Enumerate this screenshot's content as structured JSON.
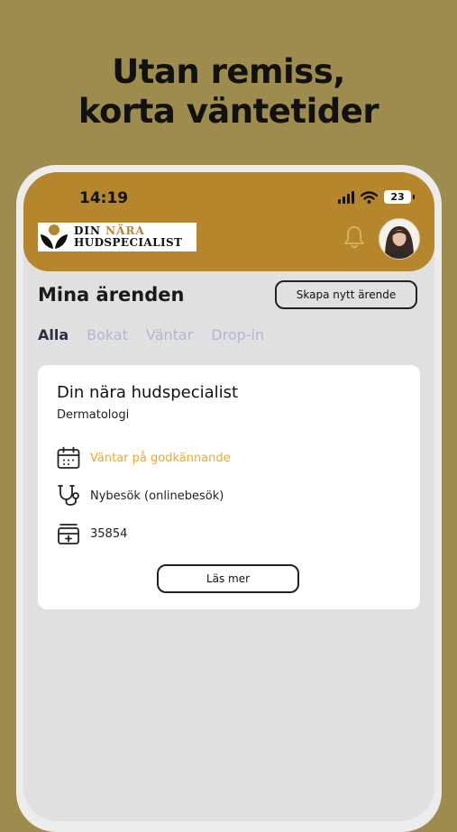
{
  "promo": {
    "headline_line1": "Utan remiss,",
    "headline_line2": "korta väntetider"
  },
  "status_bar": {
    "time": "14:19",
    "battery": "23"
  },
  "header": {
    "logo": {
      "line1_a": "DIN ",
      "line1_b": "NÄRA",
      "line2": "HUDSPECIALIST"
    },
    "icons": {
      "bell": "bell-icon",
      "avatar": "avatar"
    },
    "accent_color": "#b5862b"
  },
  "main": {
    "title": "Mina ärenden",
    "create_button": "Skapa nytt ärende",
    "tabs": [
      {
        "label": "Alla",
        "active": true
      },
      {
        "label": "Bokat",
        "active": false
      },
      {
        "label": "Väntar",
        "active": false
      },
      {
        "label": "Drop-in",
        "active": false
      }
    ]
  },
  "case_card": {
    "title": "Din nära hudspecialist",
    "subtitle": "Dermatologi",
    "rows": [
      {
        "icon": "calendar-icon",
        "text": "Väntar på godkännande",
        "color": "#f0a91b"
      },
      {
        "icon": "stethoscope-icon",
        "text": "Nybesök (onlinebesök)"
      },
      {
        "icon": "medical-record-icon",
        "text": "35854"
      }
    ],
    "read_more": "Läs mer"
  }
}
